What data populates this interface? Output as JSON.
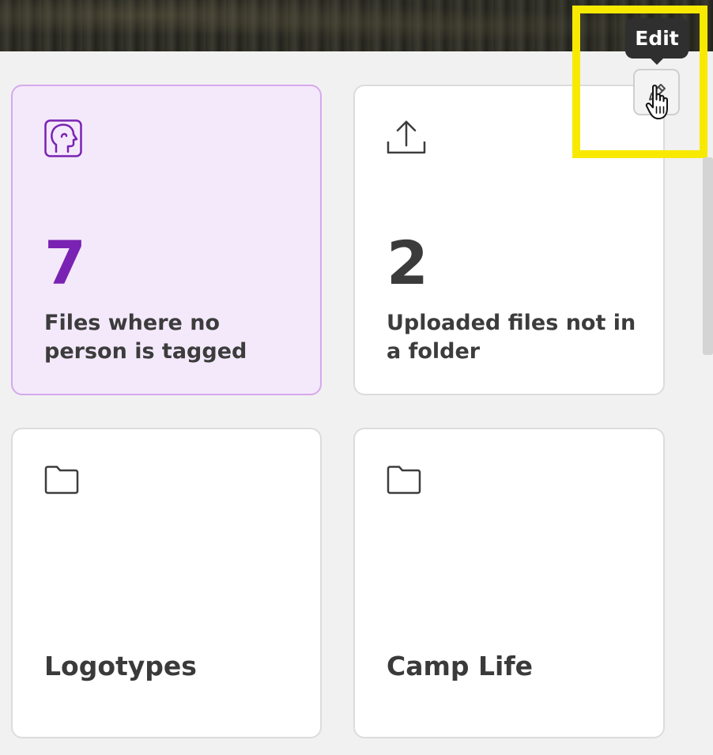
{
  "cards": [
    {
      "count": "7",
      "label": "Files where no person is tagged",
      "icon": "face-profile-icon"
    },
    {
      "count": "2",
      "label": "Uploaded files not in a folder",
      "icon": "upload-icon"
    }
  ],
  "folders": [
    {
      "title": "Logotypes",
      "icon": "folder-icon"
    },
    {
      "title": "Camp Life",
      "icon": "folder-icon"
    }
  ],
  "tooltip": {
    "text": "Edit"
  },
  "edit_button": {
    "icon": "pencil-icon"
  },
  "colors": {
    "accent": "#7a22b3",
    "highlight_card_bg": "#f4e9fb",
    "highlight_card_border": "#d5a9ec",
    "annotation_box": "#f7ea00"
  }
}
